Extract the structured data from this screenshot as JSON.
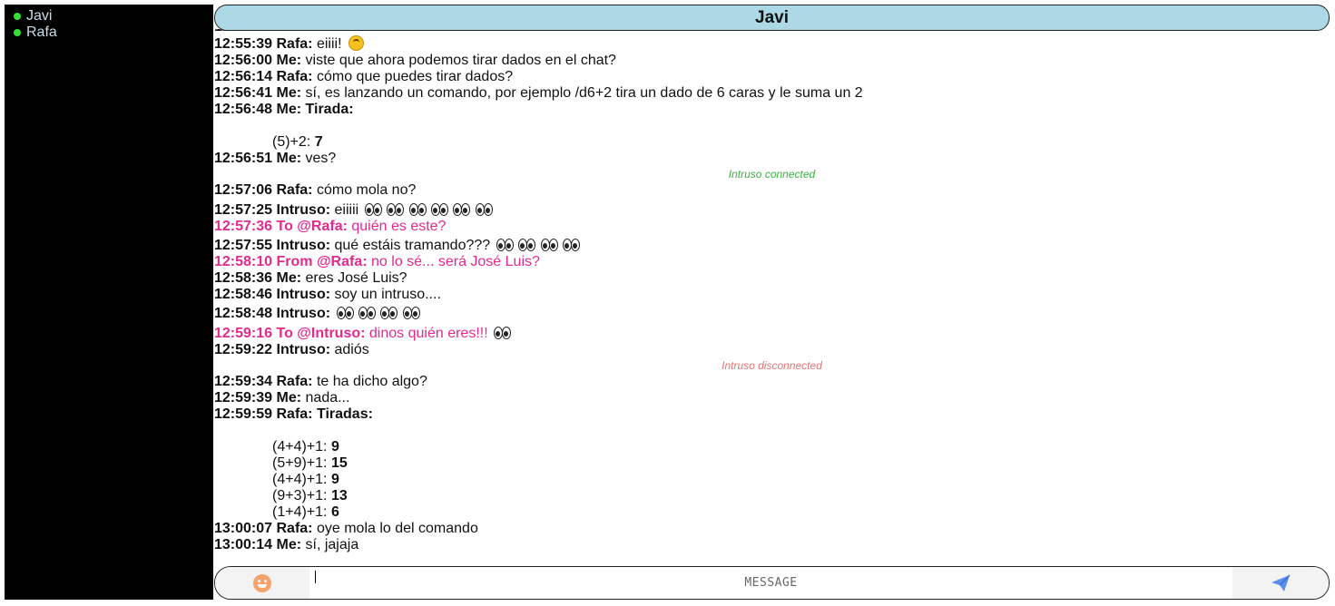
{
  "sidebar": {
    "users": [
      {
        "name": "Javi",
        "status_color": "#32e032"
      },
      {
        "name": "Rafa",
        "status_color": "#32e032"
      }
    ]
  },
  "header": {
    "title": "Javi"
  },
  "messages": [
    {
      "time": "12:55:39",
      "sender": "Rafa:",
      "text": "eiiii!"
    },
    {
      "time": "12:56:00",
      "sender": "Me:",
      "text": "viste que ahora podemos tirar dados en el chat?"
    },
    {
      "time": "12:56:14",
      "sender": "Rafa:",
      "text": "cómo que puedes tirar dados?"
    },
    {
      "time": "12:56:41",
      "sender": "Me:",
      "text": "sí, es lanzando un comando, por ejemplo /d6+2 tira un dado de 6 caras y le suma un 2"
    },
    {
      "time": "12:56:48",
      "sender": "Me:",
      "title": "Tirada:",
      "rolls": [
        {
          "expr": "(5)+2:",
          "result": "7"
        }
      ]
    },
    {
      "time": "12:56:51",
      "sender": "Me:",
      "text": "ves?"
    },
    {
      "system": "Intruso connected"
    },
    {
      "time": "12:57:06",
      "sender": "Rafa:",
      "text": "cómo mola no?"
    },
    {
      "time": "12:57:25",
      "sender": "Intruso:",
      "text": "eiiiii"
    },
    {
      "time": "12:57:36",
      "sender": "To @Rafa:",
      "text": "quién es este?"
    },
    {
      "time": "12:57:55",
      "sender": "Intruso:",
      "text": "qué estáis tramando???"
    },
    {
      "time": "12:58:10",
      "sender": "From @Rafa:",
      "text": "no lo sé... será José Luis?"
    },
    {
      "time": "12:58:36",
      "sender": "Me:",
      "text": "eres José Luis?"
    },
    {
      "time": "12:58:46",
      "sender": "Intruso:",
      "text": "soy un intruso...."
    },
    {
      "time": "12:58:48",
      "sender": "Intruso:",
      "text": ""
    },
    {
      "time": "12:59:16",
      "sender": "To @Intruso:",
      "text": "dinos quién eres!!!"
    },
    {
      "time": "12:59:22",
      "sender": "Intruso:",
      "text": "adiós"
    },
    {
      "system": "Intruso disconnected"
    },
    {
      "time": "12:59:34",
      "sender": "Rafa:",
      "text": "te ha dicho algo?"
    },
    {
      "time": "12:59:39",
      "sender": "Me:",
      "text": "nada..."
    },
    {
      "time": "12:59:59",
      "sender": "Rafa:",
      "title": "Tiradas:",
      "rolls": [
        {
          "expr": "(4+4)+1:",
          "result": "9"
        },
        {
          "expr": "(5+9)+1:",
          "result": "15"
        },
        {
          "expr": "(4+4)+1:",
          "result": "9"
        },
        {
          "expr": "(9+3)+1:",
          "result": "13"
        },
        {
          "expr": "(1+4)+1:",
          "result": "6"
        }
      ]
    },
    {
      "time": "13:00:07",
      "sender": "Rafa:",
      "text": "oye mola lo del comando"
    },
    {
      "time": "13:00:14",
      "sender": "Me:",
      "text": "sí, jajaja"
    }
  ],
  "composer": {
    "placeholder": "MESSAGE",
    "emoji_icon": "smiley-icon",
    "send_icon": "paper-plane-icon"
  },
  "colors": {
    "header_bg": "#add8e6",
    "whisper": "#e22a8e",
    "system_connected": "#3cb043",
    "system_disconnected": "#e57373",
    "sidebar_bg": "#000000"
  }
}
